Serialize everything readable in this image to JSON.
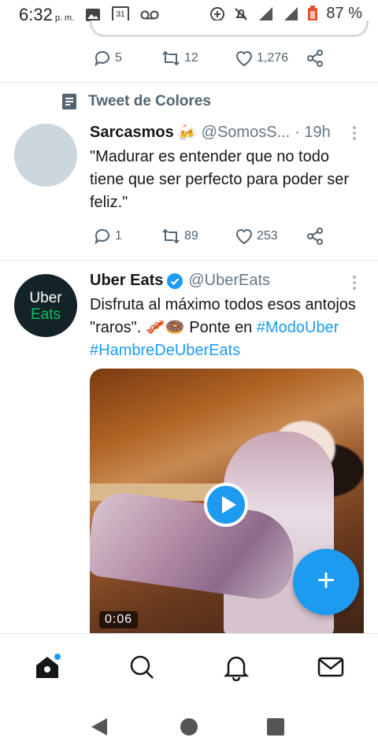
{
  "status_bar": {
    "time": "6:32",
    "ampm": "p. m.",
    "calendar_day": "31",
    "battery": "87 %"
  },
  "tweet_prev": {
    "replies": "5",
    "retweets": "12",
    "likes": "1,276"
  },
  "tweet_sarcasmos": {
    "topic": "Tweet de Colores",
    "name": "Sarcasmos",
    "name_emoji": "🍻",
    "handle": "@SomosS...",
    "time": "· 19h",
    "text": "\"Madurar es entender que no todo tiene que ser perfecto para poder ser feliz.\"",
    "replies": "1",
    "retweets": "89",
    "likes": "253"
  },
  "tweet_uber": {
    "avatar_line1": "Uber",
    "avatar_line2": "Eats",
    "name": "Uber Eats",
    "handle": "@UberEats",
    "text_main": "Disfruta al máximo todos esos antojos \"raros\". 🥓🍩 Ponte en",
    "hashtag1": "#ModoUber",
    "hashtag2": "#HambreDeUberEats",
    "video_duration": "0:06"
  },
  "fab": {
    "label": "+"
  },
  "colors": {
    "accent": "#1d9bf0",
    "uber_green": "#06c167"
  },
  "tabs": [
    "home-icon",
    "search-icon",
    "notifications-icon",
    "messages-icon"
  ]
}
